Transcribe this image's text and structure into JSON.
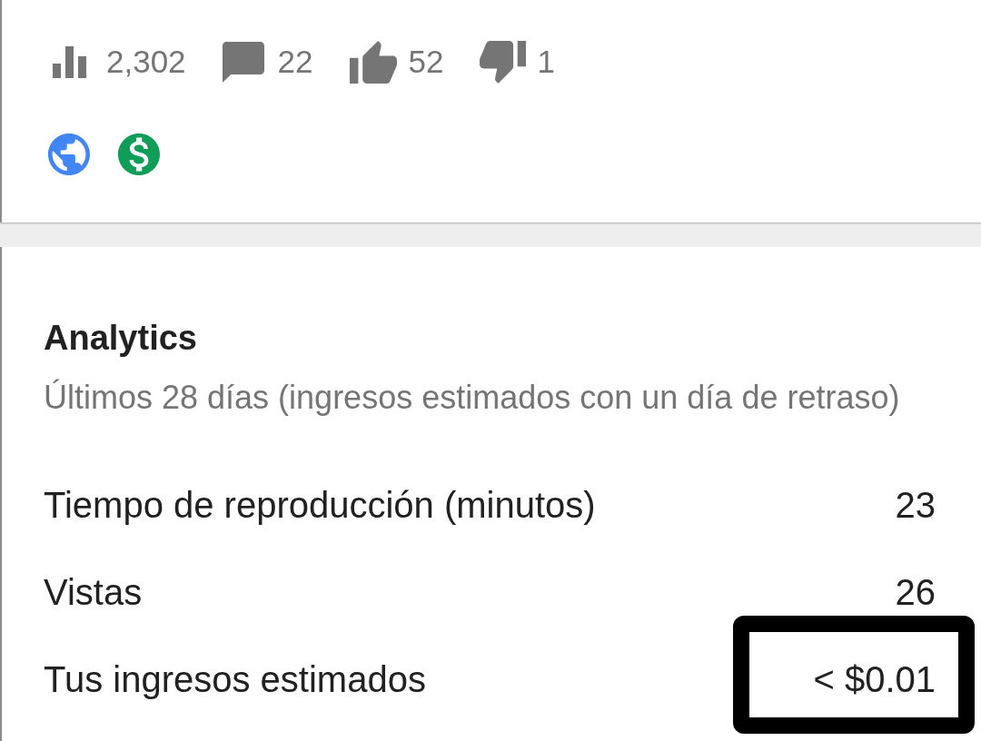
{
  "video_stats": [
    {
      "kind": "views",
      "count": "2,302"
    },
    {
      "kind": "comments",
      "count": "22"
    },
    {
      "kind": "likes",
      "count": "52"
    },
    {
      "kind": "dislikes",
      "count": "1"
    }
  ],
  "status_icons": [
    {
      "kind": "globe"
    },
    {
      "kind": "dollar"
    }
  ],
  "analytics": {
    "title": "Analytics",
    "subtitle": "Últimos 28 días (ingresos estimados con un día de retraso)",
    "rows": [
      {
        "label": "Tiempo de reproducción (minutos)",
        "value": "23",
        "highlighted": false
      },
      {
        "label": "Vistas",
        "value": "26",
        "highlighted": false
      },
      {
        "label": "Tus ingresos estimados",
        "value": "< $0.01",
        "highlighted": true
      }
    ]
  }
}
